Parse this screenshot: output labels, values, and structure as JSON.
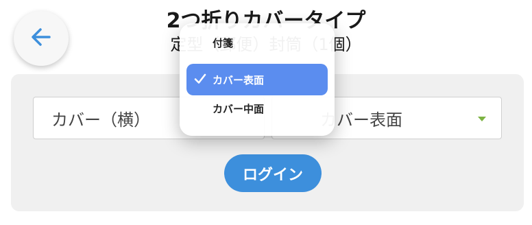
{
  "header": {
    "title": "2つ折りカバータイプ",
    "subtitle": "定型（郵便）封筒（1個）"
  },
  "form": {
    "left_select_value": "カバー（横）",
    "right_select_value": "カバー表面",
    "login_label": "ログイン"
  },
  "dropdown": {
    "options": [
      {
        "label": "付箋",
        "selected": false
      },
      {
        "label": "カバー表面",
        "selected": true
      },
      {
        "label": "カバー中面",
        "selected": false
      }
    ]
  },
  "colors": {
    "accent": "#3d8fdc",
    "selected_option": "#5b8def",
    "arrow": "#7cb342"
  }
}
